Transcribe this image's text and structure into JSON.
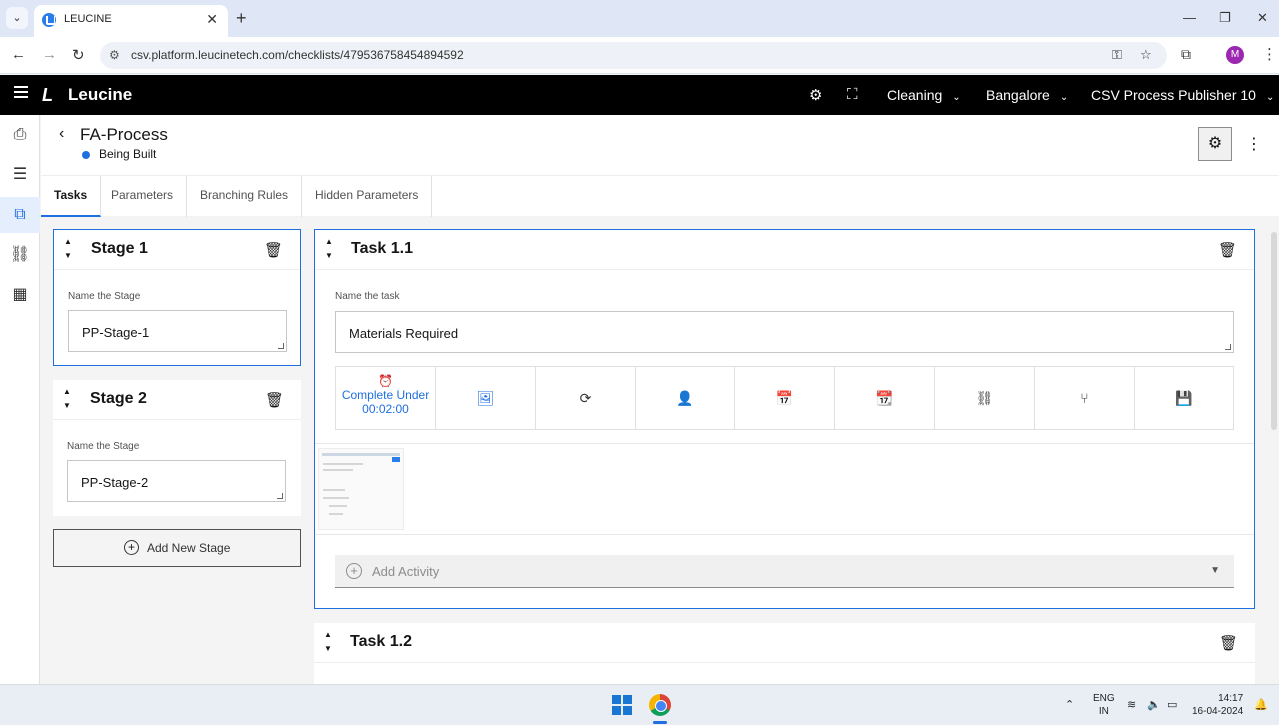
{
  "browser": {
    "tab_title": "LEUCINE",
    "url": "csv.platform.leucinetech.com/checklists/479536758454894592",
    "profile_initial": "M"
  },
  "header": {
    "brand": "Leucine",
    "use_case": "Cleaning",
    "facility": "Bangalore",
    "role": "CSV Process Publisher 10"
  },
  "page": {
    "title": "FA-Process",
    "status": "Being Built",
    "status_color": "#1f6fe0"
  },
  "tabs": [
    {
      "label": "Tasks",
      "active": true
    },
    {
      "label": "Parameters",
      "active": false
    },
    {
      "label": "Branching Rules",
      "active": false
    },
    {
      "label": "Hidden Parameters",
      "active": false
    }
  ],
  "stages": [
    {
      "title": "Stage 1",
      "field_label": "Name the Stage",
      "name": "PP-Stage-1",
      "selected": true
    },
    {
      "title": "Stage 2",
      "field_label": "Name the Stage",
      "name": "PP-Stage-2",
      "selected": false
    }
  ],
  "add_stage_label": "Add New Stage",
  "task": {
    "title": "Task 1.1",
    "field_label": "Name the task",
    "name": "Materials Required",
    "timer_label": "Complete Under",
    "timer_value": "00:02:00",
    "add_activity_label": "Add Activity"
  },
  "next_task_title": "Task 1.2",
  "taskbar": {
    "lang_1": "ENG",
    "lang_2": "IN",
    "time": "14:17",
    "date": "16-04-2024"
  },
  "icons": {
    "toolbar": [
      "alarm-icon",
      "media-icon",
      "recurrence-icon",
      "assignee-icon",
      "schedule-icon",
      "due-date-icon",
      "hierarchy-icon",
      "branch-icon",
      "save-icon"
    ]
  },
  "colors": {
    "accent": "#1f6fe0",
    "appbar": "#000000"
  }
}
